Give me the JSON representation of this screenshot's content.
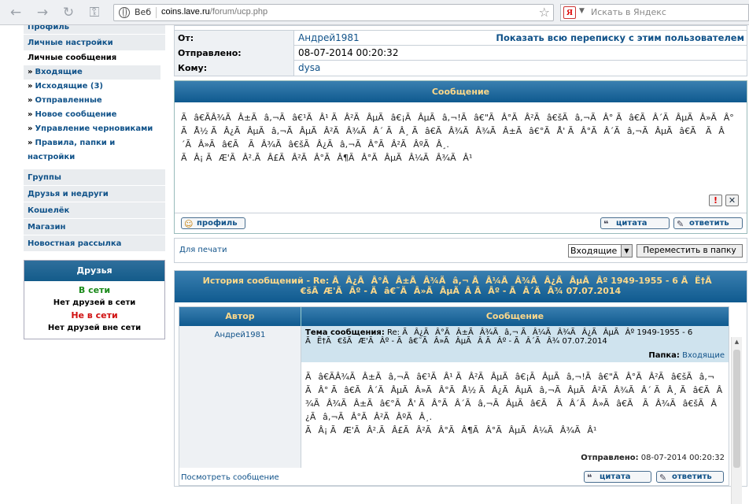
{
  "browser": {
    "web_label": "Веб",
    "url_host": "coins.lave.ru",
    "url_path": "/forum/ucp.php",
    "search_placeholder": "Искать в Яндекс",
    "search_logo": "Я"
  },
  "leftnav": {
    "profile": "Профиль",
    "personal_settings": "Личные настройки",
    "pm_header": "Личные сообщения",
    "pm_items": [
      {
        "bullet": "»",
        "label": "Входящие"
      },
      {
        "bullet": "»",
        "label": "Исходящие (3)"
      },
      {
        "bullet": "»",
        "label": "Отправленные"
      },
      {
        "bullet": "»",
        "label": "Новое сообщение"
      },
      {
        "bullet": "»",
        "label": "Управление черновиками"
      },
      {
        "bullet": "»",
        "label": "Правила, папки и настройки"
      }
    ],
    "groups": "Группы",
    "friends_foes": "Друзья и недруги",
    "wallet": "Кошелёк",
    "shop": "Магазин",
    "newsletter": "Новостная рассылка"
  },
  "friends": {
    "title": "Друзья",
    "online": "В сети",
    "no_online": "Нет друзей в сети",
    "offline": "Не в сети",
    "no_offline": "Нет друзей вне сети"
  },
  "header_info": {
    "from_label": "От:",
    "from_value": "Андрей1981",
    "show_all": "Показать всю переписку с этим пользователем",
    "sent_label": "Отправлено:",
    "sent_value": "08-07-2014 00:20:32",
    "to_label": "Кому:",
    "to_value": "dysa"
  },
  "message": {
    "title": "Сообщение",
    "body_lines": [
      "Ãâ€ÃÂ¾ÃÂ±Ãâ,¬Ãâ€¹ÃÂ¹ ÃÂ²ÃÂµÃâ€¡ÃÂµÃâ,¬!Ãâ€\"ÃÂ°ÃÂ²Ãâ€šÃâ,¬ÃÂ° Ãâ€ÃÂ´ÃÂµÃÂ»ÃÂ°ÃÅ½ ÃÂ¿ÃÂµÃâ,¬ÃÂµÃÂ²ÃÂ¾ÃÂ´ ÃÂ¸ Ãâ€ÃÂ¾ÃÂ¾ÃÂ±Ãâ€°ÃÅ' ÃÂ°ÃÂ´Ãâ,¬ÃÂµÃâ€Ã ÃÂ´ÃÂ»Ãâ€Ã ÃÂ¾Ãâ€šÃÂ¿Ãâ,¬ÃÂ°ÃÂ²ÃÂºÃÂ¸.",
      "ÃÂ¡ ÃÆ'ÃÂ².ÃÂ£ÃÂ²ÃÂ°ÃÂ¶ÃÂ°ÃÂµÃÂ¼ÃÂ¾ÃÂ¹"
    ],
    "profile_btn": "профиль",
    "quote_btn": "цитата",
    "reply_btn": "ответить"
  },
  "print_row": {
    "print_link": "Для печати",
    "folder_select": "Входящие",
    "move_btn": "Переместить в папку"
  },
  "history": {
    "title_line1": "История сообщений - Re: ÃÂ¿ÃÂ°ÃÂ±ÃÂ¾Ãâ,¬ ÃÂ¼ÃÂ¾ÃÂ¿ÃÂµÃÂº 1949-1955 - 6 ÃË†Ã",
    "title_line2": "€šÃÆ'ÃÂº - Ãâ€˜ÃÂ»ÃÂµÃÂ ÃÂº - ÃÂ´ÃÂ¾ 07.07.2014",
    "col_author": "Автор",
    "col_message": "Сообщение",
    "author": "Андрей1981",
    "subject_label": "Тема сообщения:",
    "subject_value": "Re: ÃÂ¿ÃÂ°ÃÂ±ÃÂ¾Ãâ,¬ ÃÂ¼ÃÂ¾ÃÂ¿ÃÂµÃÂº 1949-1955 - 6 ÃË†Ã€šÃÆ'ÃÂº - Ãâ€˜ÃÂ»ÃÂµÃÂ ÃÂº - ÃÂ´ÃÂ¾ 07.07.2014",
    "folder_label": "Папка:",
    "folder_value": "Входящие",
    "body_lines": [
      "Ãâ€ÃÂ¾ÃÂ±Ãâ,¬Ãâ€¹ÃÂ¹ ÃÂ²ÃÂµÃâ€¡ÃÂµÃâ,¬!Ãâ€\"ÃÂ°ÃÂ²Ãâ€šÃâ,¬ÃÂ° Ãâ€ÃÂ´ÃÂµÃÂ»ÃÂ°ÃÅ½ ÃÂ¿ÃÂµÃâ,¬ÃÂµÃÂ²ÃÂ¾ÃÂ´ ÃÂ¸ Ãâ€ÃÂ¾ÃÂ¾ÃÂ±Ãâ€°ÃÅ' ÃÂ°ÃÂ´Ãâ,¬ÃÂµÃâ€Ã ÃÂ´ÃÂ»Ãâ€Ã ÃÂ¾Ãâ€šÃÂ¿Ãâ,¬ÃÂ°ÃÂ²ÃÂºÃÂ¸.",
      "ÃÂ¡ ÃÆ'ÃÂ².ÃÂ£ÃÂ²ÃÂ°ÃÂ¶ÃÂ°ÃÂµÃÂ¼ÃÂ¾ÃÂ¹"
    ],
    "sent_label": "Отправлено:",
    "sent_value": "08-07-2014 00:20:32",
    "view_link": "Посмотреть сообщение",
    "quote_btn": "цитата",
    "reply_btn": "ответить"
  },
  "colors": {
    "link": "#105289",
    "header_gradient_top": "#3a7fb0",
    "header_gradient_bottom": "#0f5a8f",
    "header_text": "#ffd98a",
    "online": "#1a8a1a",
    "offline": "#d01010"
  }
}
